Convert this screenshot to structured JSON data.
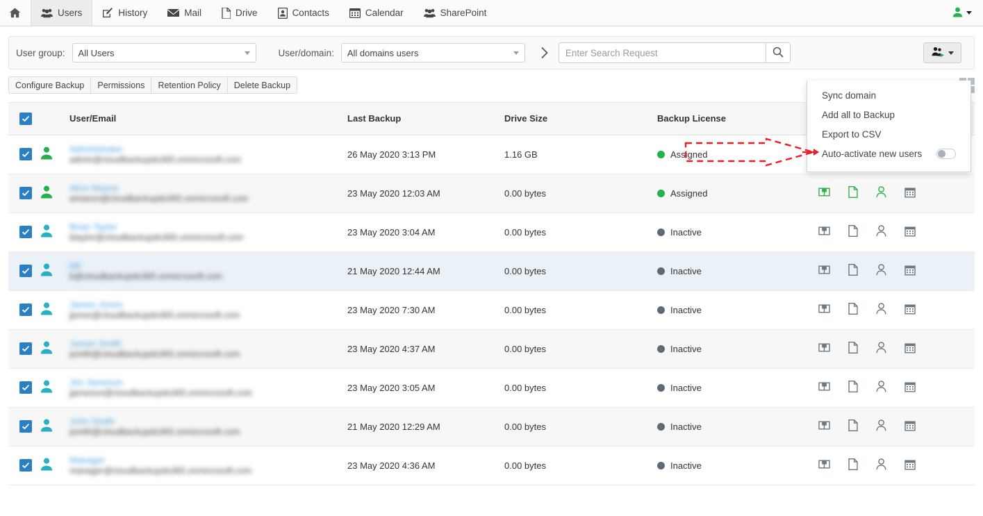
{
  "topnav": {
    "items": [
      {
        "label": "",
        "icon": "home-icon",
        "name": "home",
        "active": false
      },
      {
        "label": "Users",
        "icon": "users-icon",
        "name": "users",
        "active": true
      },
      {
        "label": "History",
        "icon": "history-icon",
        "name": "history",
        "active": false
      },
      {
        "label": "Mail",
        "icon": "mail-icon",
        "name": "mail",
        "active": false
      },
      {
        "label": "Drive",
        "icon": "drive-icon",
        "name": "drive",
        "active": false
      },
      {
        "label": "Contacts",
        "icon": "contacts-icon",
        "name": "contacts",
        "active": false
      },
      {
        "label": "Calendar",
        "icon": "calendar-icon",
        "name": "calendar",
        "active": false
      },
      {
        "label": "SharePoint",
        "icon": "sharepoint-icon",
        "name": "sharepoint",
        "active": false
      }
    ],
    "account_icon": "user-green-icon"
  },
  "filterbar": {
    "user_group_label": "User group:",
    "user_group_value": "All Users",
    "user_domain_label": "User/domain:",
    "user_domain_value": "All domains users",
    "next_icon": "chevron-right-icon",
    "search_placeholder": "Enter Search Request",
    "search_value": "",
    "search_icon": "search-icon",
    "users_menu_icon": "users-add-icon"
  },
  "actionbar": {
    "buttons": [
      "Configure Backup",
      "Permissions",
      "Retention Policy",
      "Delete Backup"
    ],
    "grid_icon": "grid-view-icon"
  },
  "menu": {
    "items": [
      {
        "label": "Sync domain",
        "type": "action"
      },
      {
        "label": "Add all to Backup",
        "type": "action"
      },
      {
        "label": "Export to CSV",
        "type": "action"
      },
      {
        "label": "Auto-activate new users",
        "type": "toggle",
        "toggle_on": false
      }
    ]
  },
  "annotation": {
    "type": "red-dashed-arrow",
    "color": "#ee1c25",
    "points_to": "Auto-activate new users"
  },
  "table": {
    "headers": [
      "",
      "",
      "User/Email",
      "Last Backup",
      "Drive Size",
      "Backup License",
      ""
    ],
    "select_all_checked": true,
    "rows": [
      {
        "checked": true,
        "avatar_color": "green",
        "name": "Administrator",
        "email": "admin@cloudbackupdo365.onmicrosoft.com",
        "last_backup": "26 May 2020 3:13 PM",
        "drive_size": "1.16 GB",
        "license": "Assigned",
        "icons": [
          "green",
          "green",
          "green",
          "green"
        ],
        "row_state": "odd"
      },
      {
        "checked": true,
        "avatar_color": "green",
        "name": "Alice Mason",
        "email": "amason@cloudbackupdo365.onmicrosoft.com",
        "last_backup": "23 May 2020 12:03 AM",
        "drive_size": "0.00 bytes",
        "license": "Assigned",
        "icons": [
          "green",
          "green",
          "green",
          "gray"
        ],
        "row_state": "even"
      },
      {
        "checked": true,
        "avatar_color": "cyan",
        "name": "Brian Taylor",
        "email": "btaylor@cloudbackupdo365.onmicrosoft.com",
        "last_backup": "23 May 2020 3:04 AM",
        "drive_size": "0.00 bytes",
        "license": "Inactive",
        "icons": [
          "gray",
          "gray",
          "gray",
          "gray"
        ],
        "row_state": "odd"
      },
      {
        "checked": true,
        "avatar_color": "cyan",
        "name": "bill",
        "email": "b@cloudbackupdo365.onmicrosoft.com",
        "last_backup": "21 May 2020 12:44 AM",
        "drive_size": "0.00 bytes",
        "license": "Inactive",
        "icons": [
          "gray",
          "gray",
          "gray",
          "gray"
        ],
        "row_state": "hover"
      },
      {
        "checked": true,
        "avatar_color": "cyan",
        "name": "James Jones",
        "email": "jjones@cloudbackupdo365.onmicrosoft.com",
        "last_backup": "23 May 2020 7:30 AM",
        "drive_size": "0.00 bytes",
        "license": "Inactive",
        "icons": [
          "gray",
          "gray",
          "gray",
          "gray"
        ],
        "row_state": "odd"
      },
      {
        "checked": true,
        "avatar_color": "cyan",
        "name": "James Smith",
        "email": "jsmith@cloudbackupdo365.onmicrosoft.com",
        "last_backup": "23 May 2020 4:37 AM",
        "drive_size": "0.00 bytes",
        "license": "Inactive",
        "icons": [
          "gray",
          "gray",
          "gray",
          "gray"
        ],
        "row_state": "even"
      },
      {
        "checked": true,
        "avatar_color": "cyan",
        "name": "Jim Jameson",
        "email": "jjameson@cloudbackupdo365.onmicrosoft.com",
        "last_backup": "23 May 2020 3:05 AM",
        "drive_size": "0.00 bytes",
        "license": "Inactive",
        "icons": [
          "gray",
          "gray",
          "gray",
          "gray"
        ],
        "row_state": "odd"
      },
      {
        "checked": true,
        "avatar_color": "cyan",
        "name": "John Smith",
        "email": "jsmith@cloudbackupdo365.onmicrosoft.com",
        "last_backup": "21 May 2020 12:29 AM",
        "drive_size": "0.00 bytes",
        "license": "Inactive",
        "icons": [
          "gray",
          "gray",
          "gray",
          "gray"
        ],
        "row_state": "even"
      },
      {
        "checked": true,
        "avatar_color": "cyan",
        "name": "Manager",
        "email": "manager@cloudbackupdo365.onmicrosoft.com",
        "last_backup": "23 May 2020 4:36 AM",
        "drive_size": "0.00 bytes",
        "license": "Inactive",
        "icons": [
          "gray",
          "gray",
          "gray",
          "gray"
        ],
        "row_state": "odd"
      }
    ]
  },
  "colors": {
    "accent_blue": "#2b7fc4",
    "link_blue": "#4aa3e0",
    "status_assigned": "#22b14c",
    "status_inactive": "#5f6b74",
    "avatar_green": "#22b14c",
    "avatar_cyan": "#2aaec4",
    "icon_active": "#2fb04a",
    "icon_inactive": "#6b7781",
    "annotation_red": "#ee1c25"
  }
}
